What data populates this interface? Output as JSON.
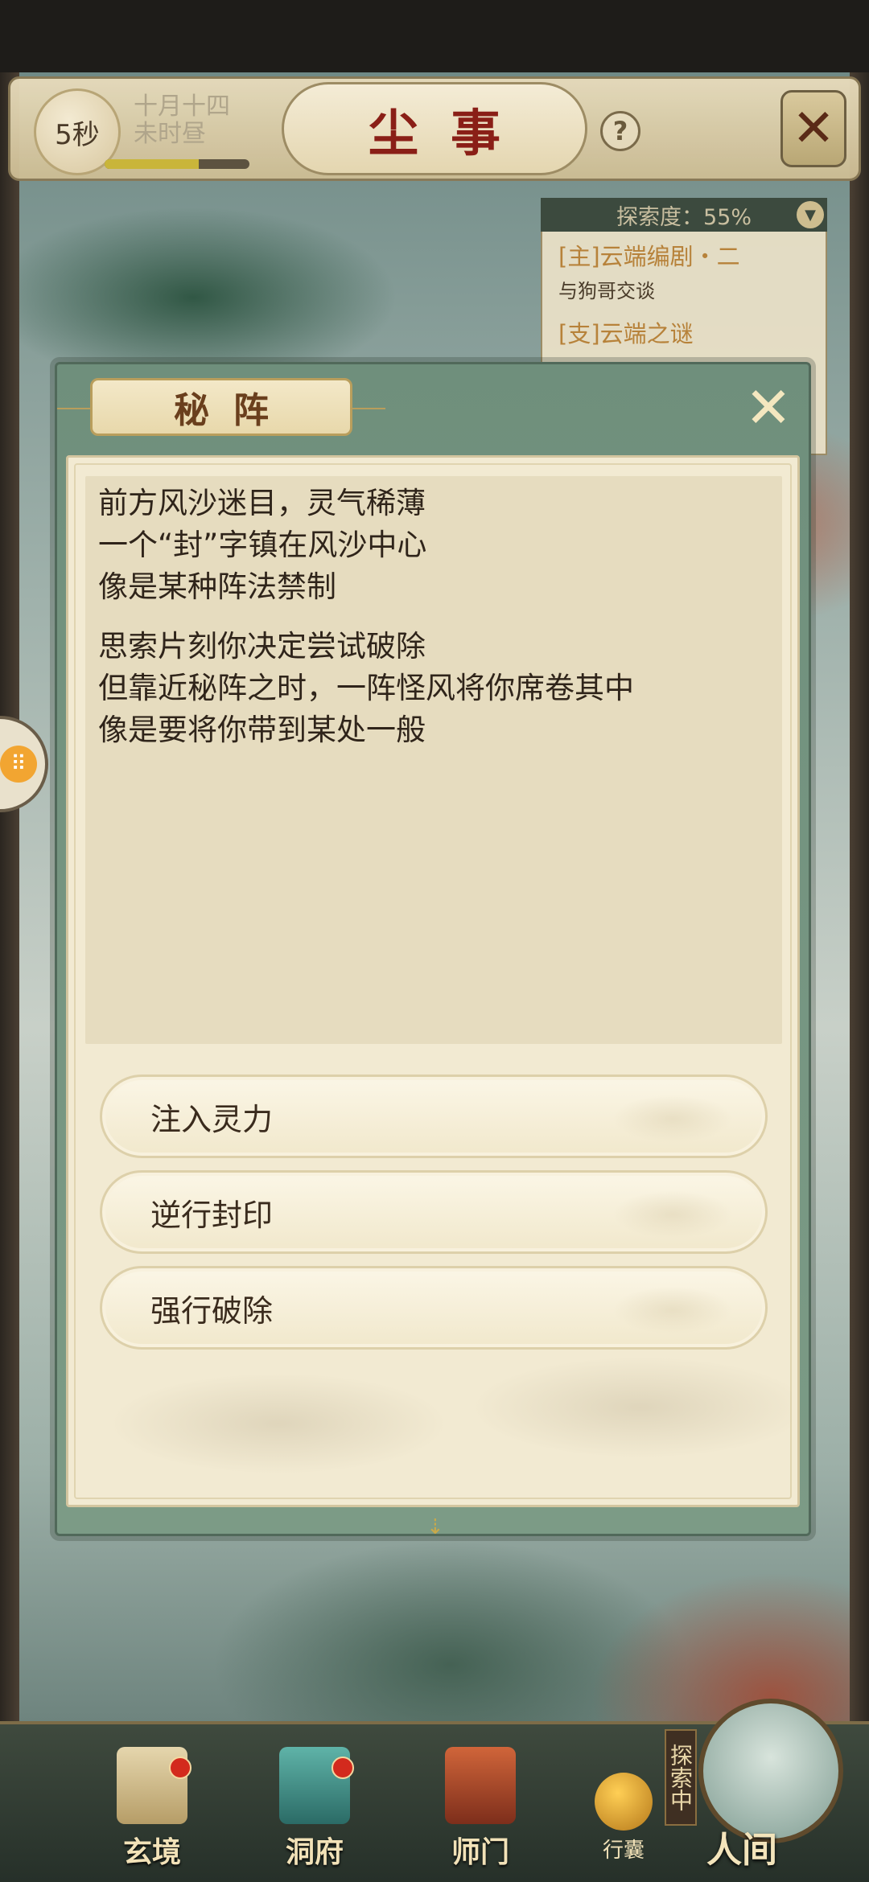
{
  "topbar": {
    "timer": "5秒",
    "date_line1": "十月十四",
    "date_line2": "未时昼",
    "progress": 0.65,
    "title": "尘事",
    "help_label": "?"
  },
  "quest_panel": {
    "explore_label": "探索度：55%",
    "items": [
      {
        "title": "[主]云端编剧・二",
        "desc": "与狗哥交谈"
      },
      {
        "title": "[支]云端之谜",
        "desc": ""
      }
    ]
  },
  "dialog": {
    "title": "秘阵",
    "story": {
      "paragraph1": [
        "前方风沙迷目，灵气稀薄",
        "一个“封”字镇在风沙中心",
        "像是某种阵法禁制"
      ],
      "paragraph2": [
        "思索片刻你决定尝试破除",
        "但靠近秘阵之时，一阵怪风将你席卷其中",
        "像是要将你带到某处一般"
      ]
    },
    "options": [
      "注入灵力",
      "逆行封印",
      "强行破除"
    ]
  },
  "bottom_nav": {
    "items": [
      {
        "label": "玄境",
        "badge": true
      },
      {
        "label": "洞府",
        "badge": true
      },
      {
        "label": "师门",
        "badge": false
      }
    ],
    "bag_label": "行囊",
    "explore_tag": "探索中",
    "world_label": "人间"
  },
  "colors": {
    "title_red": "#8a1f17",
    "dialog_green": "#7c9b86",
    "paper": "#f2ead2",
    "badge_red": "#d32a1d"
  }
}
